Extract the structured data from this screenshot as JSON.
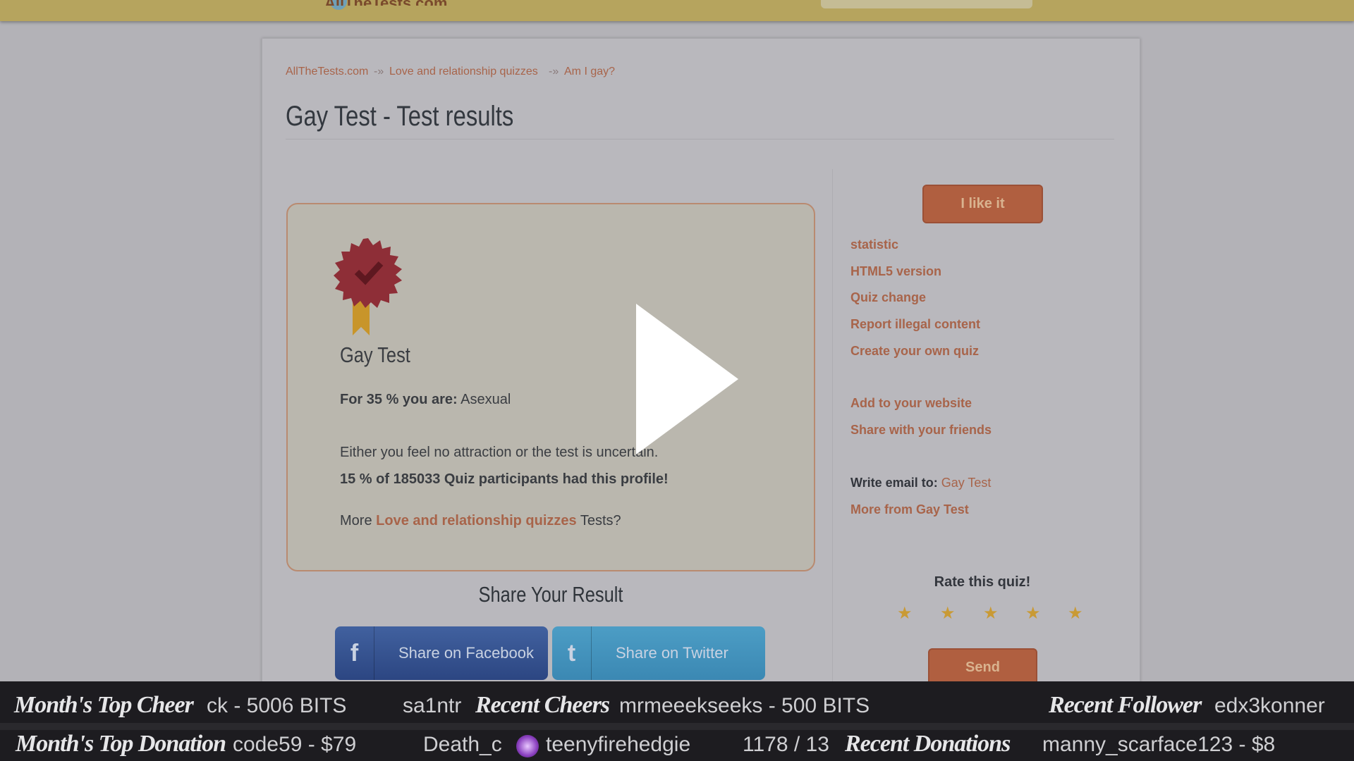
{
  "header": {
    "logo_text": "AllTheTests.com"
  },
  "breadcrumb": {
    "home": "AllTheTests.com",
    "sep": "-»",
    "category": "Love and relationship quizzes",
    "current": "Am I gay?"
  },
  "page_title": "Gay Test - Test results",
  "result": {
    "quiz_name": "Gay Test",
    "percent_label": "For 35 % you are:",
    "result_value": "Asexual",
    "description": "Either you feel no attraction or the test is uncertain.",
    "stat": "15 % of 185033 Quiz participants had this profile!",
    "more_prefix": "More",
    "more_link": "Love and relationship quizzes",
    "more_suffix": "Tests?"
  },
  "share": {
    "heading": "Share Your Result",
    "facebook": "Share on Facebook",
    "twitter": "Share on Twitter"
  },
  "sidebar": {
    "like_button": "I like it",
    "links": [
      "statistic",
      "HTML5 version",
      "Quiz change",
      "Report illegal content",
      "Create your own quiz",
      "Add to your website",
      "Share with your friends"
    ],
    "email_label": "Write email to:",
    "email_link": "Gay Test",
    "more_from": "More from Gay Test",
    "rate_heading": "Rate this quiz!",
    "star_count": 5,
    "send_button": "Send"
  },
  "stream_overlay": {
    "row1": {
      "label_top_cheer": "Month's Top Cheer",
      "top_cheer": "ck - 5006 BITS",
      "partial": "sa1ntr",
      "label_recent_cheers": "Recent Cheers",
      "recent_cheer": "mrmeeekseeks - 500 BITS",
      "label_recent_follower": "Recent Follower",
      "recent_follower": "edx3konner"
    },
    "row2": {
      "label_top_donation": "Month's Top Donation",
      "top_donation": "code59 - $79",
      "partial": "Death_c",
      "viewer": "teenyfirehedgie",
      "counter": "1178 / 13",
      "label_recent_donations": "Recent Donations",
      "recent_donation": "manny_scarface123 - $8"
    }
  },
  "colors": {
    "link": "#a8644a",
    "button": "#b05f40",
    "facebook": "#3b5998",
    "twitter": "#4c9dc5"
  }
}
